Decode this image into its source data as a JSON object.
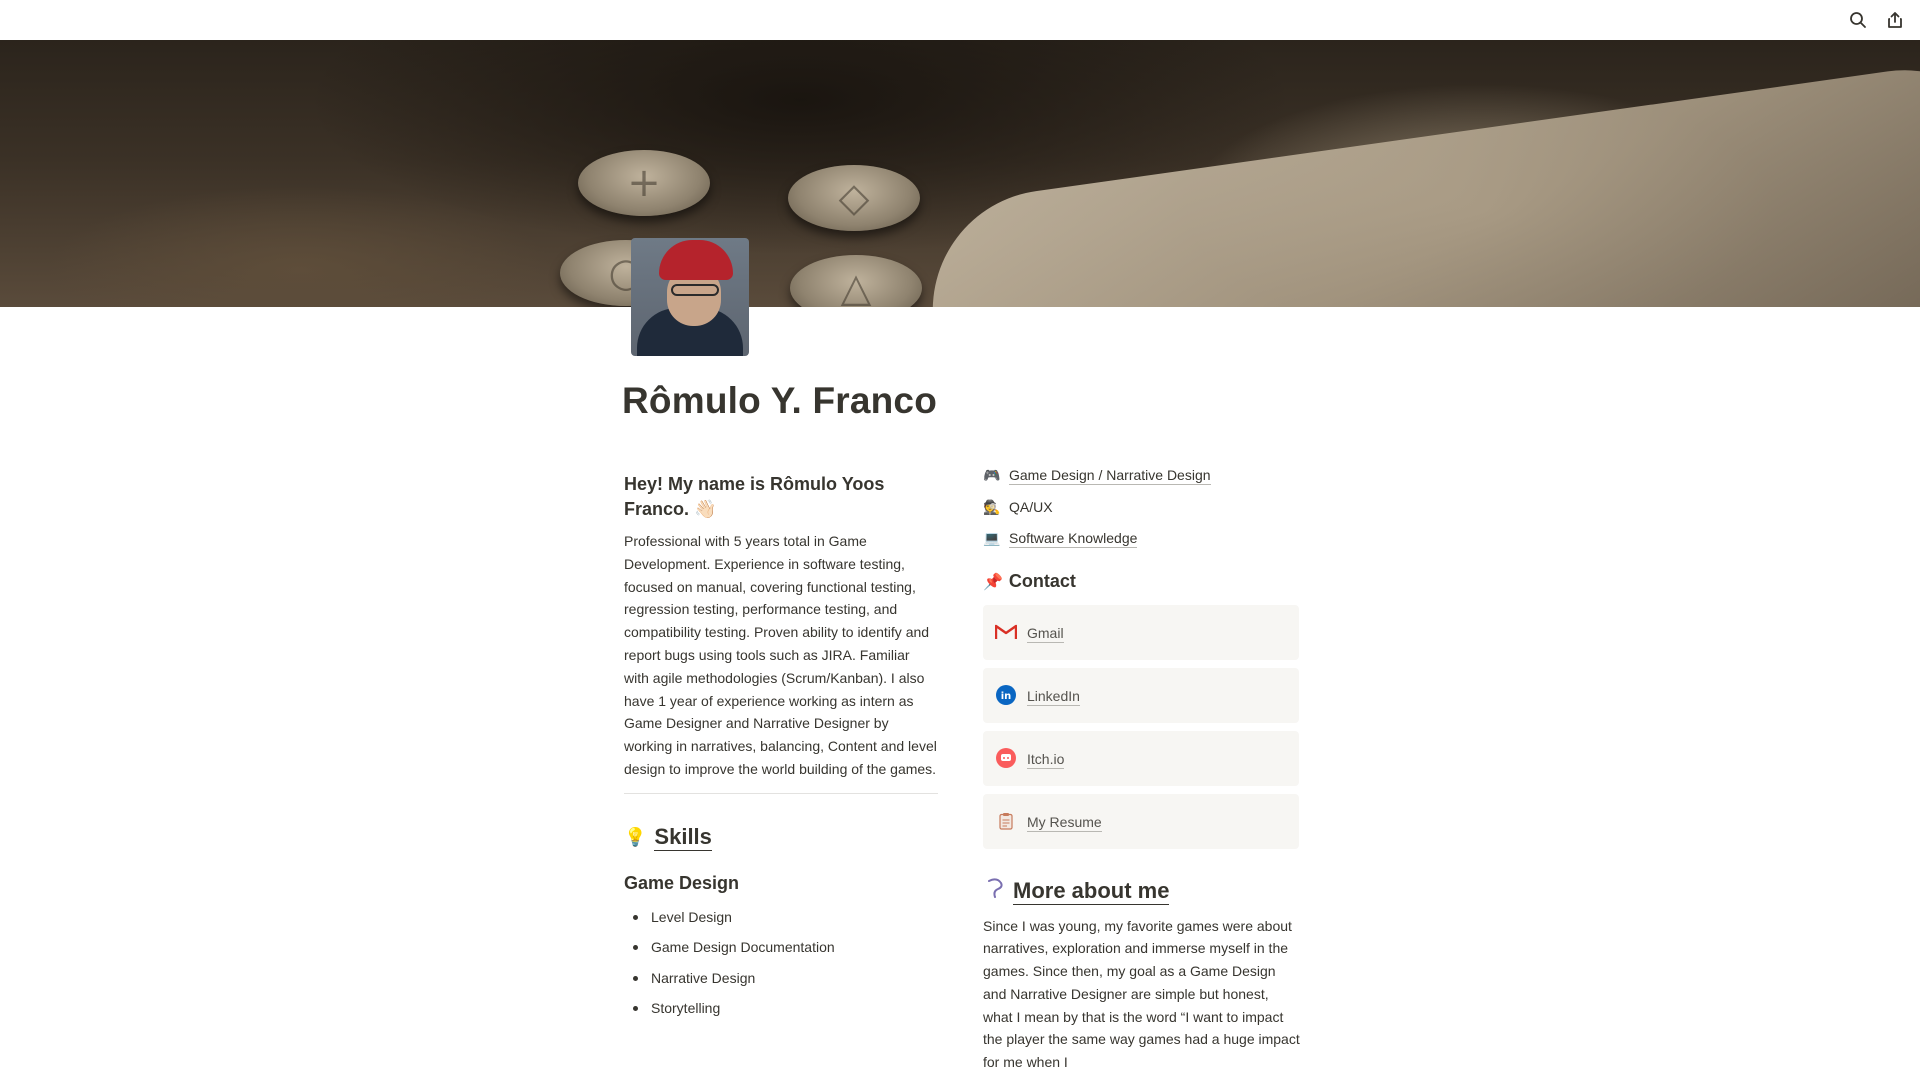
{
  "topbar": {
    "search_icon": "search-icon",
    "share_icon": "share-icon"
  },
  "page": {
    "title": "Rômulo Y. Franco"
  },
  "intro": {
    "heading": "Hey! My name is Rômulo Yoos Franco. 👋🏻",
    "bio": "Professional with 5 years total in Game Development. Experience in software testing, focused on manual, covering functional testing, regression testing, performance testing, and compatibility testing. Proven ability to identify and report bugs using tools such as JIRA. Familiar with agile methodologies (Scrum/Kanban). I also have 1 year of experience working as intern as Game Designer and Narrative Designer by working in narratives, balancing, Content and level design to improve the world building of the games."
  },
  "skills": {
    "emoji": "💡",
    "heading": "Skills",
    "subheading": "Game Design",
    "items": [
      "Level Design",
      "Game Design Documentation",
      "Narrative Design",
      "Storytelling"
    ]
  },
  "links": [
    {
      "emoji": "🎮",
      "label": "Game Design / Narrative Design"
    },
    {
      "emoji": "🕵",
      "label": "QA/UX"
    },
    {
      "emoji": "💻",
      "label": "Software Knowledge"
    }
  ],
  "contact": {
    "emoji": "📌",
    "heading": "Contact",
    "cards": [
      {
        "icon": "gmail-icon",
        "label": "Gmail"
      },
      {
        "icon": "linkedin-icon",
        "label": "LinkedIn"
      },
      {
        "icon": "itchio-icon",
        "label": "Itch.io"
      },
      {
        "icon": "clipboard-icon",
        "label": "My Resume"
      }
    ]
  },
  "more": {
    "emoji": "🪝",
    "heading": "More about me",
    "text": "Since I was young, my favorite games were about narratives, exploration and immerse myself in the games. Since then, my goal as a Game Design and Narrative Designer are simple but honest, what I mean by that is the word “I want to impact the player the same way games had a huge impact for me when I"
  },
  "colors": {
    "text": "#37352f",
    "card_bg": "#f7f6f3",
    "gmail_red": "#d93025",
    "linkedin_blue": "#0a66c2",
    "itch_red": "#fa5c5c"
  }
}
